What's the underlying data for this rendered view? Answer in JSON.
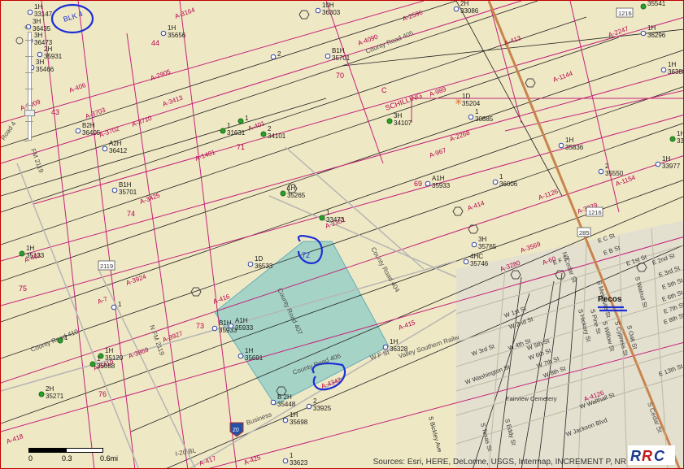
{
  "map": {
    "handwritten": {
      "blk": "BLK 4",
      "block_number": "72"
    },
    "city": "Pecos",
    "attribution": "Sources: Esri, HERE, DeLorme, USGS, Intermap, INCREMENT P, NR",
    "scale": {
      "labels": [
        "0",
        "0.3",
        "0.6mi"
      ]
    },
    "logo_text": "RRC",
    "colors": {
      "base": "#efe8c4",
      "survey_line": "#c3227a",
      "parcel": "#9fd3c7",
      "annotation": "#1d2fd6",
      "railroad": "#c8844e"
    },
    "tracts": [
      {
        "id": "a2009",
        "text": "A-2009"
      },
      {
        "id": "a406",
        "text": "A-406"
      },
      {
        "id": "a3703",
        "text": "A-3703"
      },
      {
        "id": "a3702",
        "text": "A-3702"
      },
      {
        "id": "a3710",
        "text": "A-3710"
      },
      {
        "id": "a3413",
        "text": "A-3413"
      },
      {
        "id": "a2905",
        "text": "A-2905"
      },
      {
        "id": "a401",
        "text": "A-401"
      },
      {
        "id": "a3164",
        "text": "A-3164"
      },
      {
        "id": "a4090",
        "text": "A-4090"
      },
      {
        "id": "a2596",
        "text": "A-2596"
      },
      {
        "id": "a413",
        "text": "A-413"
      },
      {
        "id": "a2247",
        "text": "A-2247"
      },
      {
        "id": "a989",
        "text": "A-989"
      },
      {
        "id": "a1144",
        "text": "A-1144"
      },
      {
        "id": "a2268",
        "text": "A-2268"
      },
      {
        "id": "a967",
        "text": "A-967"
      },
      {
        "id": "a1401",
        "text": "A-1401"
      },
      {
        "id": "a3425",
        "text": "A-3425"
      },
      {
        "id": "a2351",
        "text": "A-2351"
      },
      {
        "id": "a414",
        "text": "A-414"
      },
      {
        "id": "a1126",
        "text": "A-1126"
      },
      {
        "id": "a3229",
        "text": "A-3229"
      },
      {
        "id": "a1154",
        "text": "A-1154"
      },
      {
        "id": "a402",
        "text": "A-402"
      },
      {
        "id": "a3924",
        "text": "A-3924"
      },
      {
        "id": "a7",
        "text": "A-7"
      },
      {
        "id": "a416",
        "text": "A-416"
      },
      {
        "id": "a3927",
        "text": "A-3927"
      },
      {
        "id": "a415",
        "text": "A-415"
      },
      {
        "id": "a4342",
        "text": "A-4342"
      },
      {
        "id": "a3869",
        "text": "A-3869"
      },
      {
        "id": "a5419",
        "text": "A-5419"
      },
      {
        "id": "a418",
        "text": "A-418"
      },
      {
        "id": "a417",
        "text": "A-417"
      },
      {
        "id": "a425",
        "text": "A-425"
      },
      {
        "id": "a3280",
        "text": "A-3280"
      },
      {
        "id": "a60",
        "text": "A-60"
      },
      {
        "id": "a3569",
        "text": "A-3569"
      },
      {
        "id": "a4126",
        "text": "A-4126"
      }
    ],
    "sections": [
      "44",
      "43",
      "70",
      "71",
      "72",
      "69",
      "74",
      "73",
      "75",
      "76",
      "C",
      "SCHILLING"
    ],
    "roads": [
      {
        "id": "cr405-top",
        "text": "County Road 405"
      },
      {
        "id": "road-fm",
        "text": "Road 4"
      },
      {
        "id": "fm2119",
        "text": "FM 2119"
      },
      {
        "id": "cr404",
        "text": "County Road 404"
      },
      {
        "id": "cr407",
        "text": "County Road 407"
      },
      {
        "id": "cr406",
        "text": "County Road 406"
      },
      {
        "id": "cr410",
        "text": "County Road 410"
      },
      {
        "id": "nfm2119",
        "text": "N FM 2119"
      },
      {
        "id": "i20bl",
        "text": "I-20 BL"
      },
      {
        "id": "business",
        "text": "Business"
      },
      {
        "id": "railway",
        "text": "Valley Southern Railw"
      },
      {
        "id": "wfst",
        "text": "W F St"
      },
      {
        "id": "ncedar",
        "text": "N Cedar St"
      },
      {
        "id": "scedar",
        "text": "S Cedar St"
      }
    ],
    "shields": [
      {
        "id": "s1216a",
        "text": "1216"
      },
      {
        "id": "s1216b",
        "text": "1216"
      },
      {
        "id": "s285",
        "text": "285"
      },
      {
        "id": "s2119",
        "text": "2119"
      },
      {
        "id": "s20",
        "text": "20"
      }
    ],
    "streets": [
      "W 1st St",
      "W 2nd St",
      "W 3rd St",
      "W 4th St",
      "W 5th St",
      "W 6th St",
      "W 7th St",
      "W 8th St",
      "W Washington St",
      "W Walthall St",
      "W Jackson Blvd",
      "E F St",
      "E C St",
      "E B St",
      "E 1st St",
      "E 2nd St",
      "E 3rd St",
      "E 5th St",
      "E 6th St",
      "E 7th St",
      "E 8th St",
      "E 13th St",
      "S Hickory St",
      "S Pine St",
      "S Willow St",
      "S Cypress St",
      "S Walnut St",
      "S Oak St",
      "S Mesquite St",
      "S Bickley Ave",
      "S Eddy St",
      "S Texas St",
      "Fairview Cemetery"
    ],
    "wells": [
      {
        "id": "w1",
        "label": "1H 33147",
        "kind": "open"
      },
      {
        "id": "w2",
        "label": "3H 36435",
        "kind": "open"
      },
      {
        "id": "w3",
        "label": "3H 36473",
        "kind": "open"
      },
      {
        "id": "w4",
        "label": "2H 35931",
        "kind": "open"
      },
      {
        "id": "w5",
        "label": "3H 35466",
        "kind": "open"
      },
      {
        "id": "w6",
        "label": "1H 35656",
        "kind": "open"
      },
      {
        "id": "w7",
        "label": "2",
        "kind": "open"
      },
      {
        "id": "w8",
        "label": "10H 36303",
        "kind": "open"
      },
      {
        "id": "w9",
        "label": "B1H 35701",
        "kind": "open"
      },
      {
        "id": "w10",
        "label": "2H 33086",
        "kind": "open"
      },
      {
        "id": "w11",
        "label": "35541",
        "kind": "green"
      },
      {
        "id": "w12",
        "label": "1H 36296",
        "kind": "open"
      },
      {
        "id": "w13",
        "label": "1H 36388",
        "kind": "open"
      },
      {
        "id": "w14",
        "label": "1D 35204",
        "kind": "star"
      },
      {
        "id": "w15",
        "label": "3H 34107",
        "kind": "green"
      },
      {
        "id": "w16",
        "label": "1 30885",
        "kind": "open"
      },
      {
        "id": "w17",
        "label": "1 31631",
        "kind": "green"
      },
      {
        "id": "w18",
        "label": "1",
        "kind": "green"
      },
      {
        "id": "w19",
        "label": "2 34101",
        "kind": "green"
      },
      {
        "id": "w20",
        "label": "B2H 36405",
        "kind": "open"
      },
      {
        "id": "w21",
        "label": "A2H 36412",
        "kind": "open"
      },
      {
        "id": "w22",
        "label": "1H 35836",
        "kind": "open"
      },
      {
        "id": "w23",
        "label": "1H 33142",
        "kind": "green"
      },
      {
        "id": "w24",
        "label": "2 35550",
        "kind": "open"
      },
      {
        "id": "w25",
        "label": "1H 33977",
        "kind": "open"
      },
      {
        "id": "w26",
        "label": "B1H 35701",
        "kind": "open"
      },
      {
        "id": "w27",
        "label": "1H 35265",
        "kind": "green"
      },
      {
        "id": "w28",
        "label": "A1H 35933",
        "kind": "open"
      },
      {
        "id": "w29",
        "label": "1 36006",
        "kind": "open"
      },
      {
        "id": "w30",
        "label": "1 33473",
        "kind": "green"
      },
      {
        "id": "w31",
        "label": "1H 35133",
        "kind": "green"
      },
      {
        "id": "w32",
        "label": "1D 36533",
        "kind": "open"
      },
      {
        "id": "w33",
        "label": "3H 35765",
        "kind": "open"
      },
      {
        "id": "w34",
        "label": "4HC 35746",
        "kind": "open"
      },
      {
        "id": "w35",
        "label": "1",
        "kind": "open"
      },
      {
        "id": "w36",
        "label": "B1H 35933",
        "kind": "open"
      },
      {
        "id": "w37",
        "label": "A1H 35933",
        "kind": "open"
      },
      {
        "id": "w38",
        "label": "1H 35691",
        "kind": "open"
      },
      {
        "id": "w39",
        "label": "1H 36328",
        "kind": "open"
      },
      {
        "id": "w40",
        "label": "1H 35120",
        "kind": "green"
      },
      {
        "id": "w41",
        "label": "1 35088",
        "kind": "green"
      },
      {
        "id": "w42",
        "label": "1",
        "kind": "green"
      },
      {
        "id": "w43",
        "label": "2H 35271",
        "kind": "green"
      },
      {
        "id": "w44",
        "label": "B 2H 35448",
        "kind": "open"
      },
      {
        "id": "w45",
        "label": "2 33925",
        "kind": "open"
      },
      {
        "id": "w46",
        "label": "1H 35698",
        "kind": "open"
      },
      {
        "id": "w47",
        "label": "1 33623",
        "kind": "open"
      }
    ]
  }
}
